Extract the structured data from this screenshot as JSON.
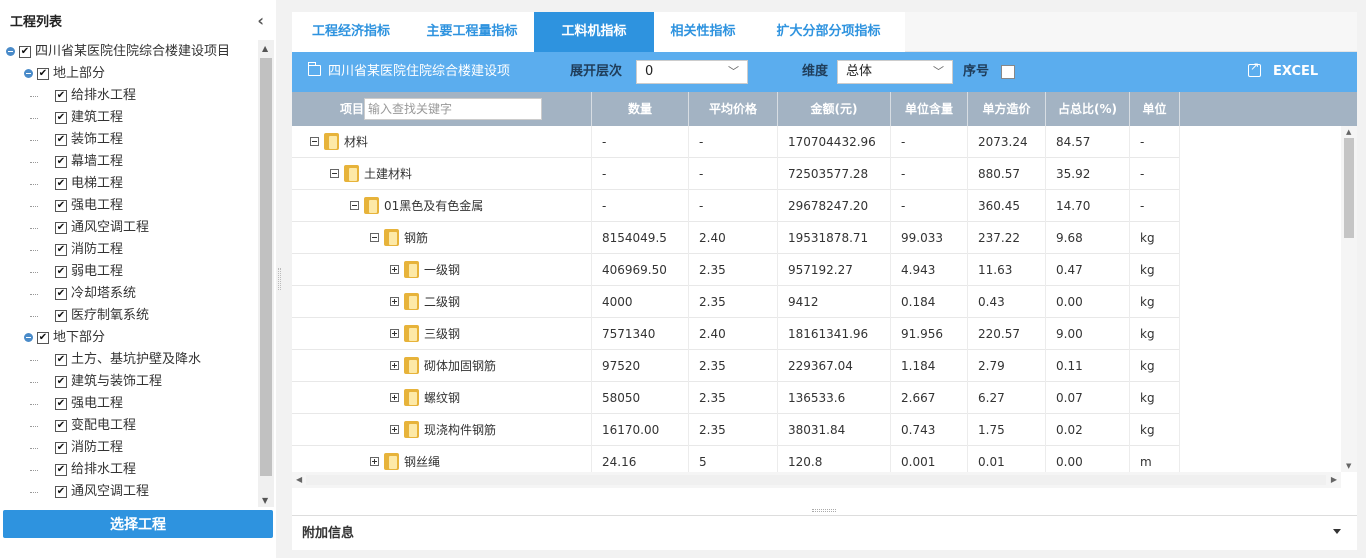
{
  "left_panel": {
    "title": "工程列表",
    "collapse_icon": "chevron-left-icon",
    "tree": [
      {
        "label": "四川省某医院住院综合楼建设项目",
        "level": 0
      },
      {
        "label": "地上部分",
        "level": 1
      },
      {
        "label": "给排水工程",
        "level": 2
      },
      {
        "label": "建筑工程",
        "level": 2
      },
      {
        "label": "装饰工程",
        "level": 2
      },
      {
        "label": "幕墙工程",
        "level": 2
      },
      {
        "label": "电梯工程",
        "level": 2
      },
      {
        "label": "强电工程",
        "level": 2
      },
      {
        "label": "通风空调工程",
        "level": 2
      },
      {
        "label": "消防工程",
        "level": 2
      },
      {
        "label": "弱电工程",
        "level": 2
      },
      {
        "label": "冷却塔系统",
        "level": 2
      },
      {
        "label": "医疗制氧系统",
        "level": 2
      },
      {
        "label": "地下部分",
        "level": 1
      },
      {
        "label": "土方、基坑护壁及降水",
        "level": 2
      },
      {
        "label": "建筑与装饰工程",
        "level": 2
      },
      {
        "label": "强电工程",
        "level": 2
      },
      {
        "label": "变配电工程",
        "level": 2
      },
      {
        "label": "消防工程",
        "level": 2
      },
      {
        "label": "给排水工程",
        "level": 2
      },
      {
        "label": "通风空调工程",
        "level": 2
      }
    ],
    "select_button": "选择工程"
  },
  "tabs": [
    "工程经济指标",
    "主要工程量指标",
    "工料机指标",
    "相关性指标",
    "扩大分部分项指标"
  ],
  "active_tab": 2,
  "toolbar": {
    "project_name": "四川省某医院住院综合楼建设项",
    "expand_level_label": "展开层次",
    "expand_level_value": "0",
    "dimension_label": "维度",
    "dimension_value": "总体",
    "seq_label": "序号",
    "excel_label": "EXCEL"
  },
  "grid": {
    "columns": [
      "项目",
      "数量",
      "平均价格",
      "金额(元)",
      "单位含量",
      "单方造价",
      "占总比(%)",
      "单位"
    ],
    "search_placeholder": "输入查找关键字",
    "rows": [
      {
        "name": "材料",
        "level": 0,
        "toggle": "minus",
        "cells": [
          "-",
          "-",
          "170704432.96",
          "-",
          "2073.24",
          "84.57",
          "-"
        ]
      },
      {
        "name": "土建材料",
        "level": 1,
        "toggle": "minus",
        "cells": [
          "-",
          "-",
          "72503577.28",
          "-",
          "880.57",
          "35.92",
          "-"
        ]
      },
      {
        "name": "01黑色及有色金属",
        "level": 2,
        "toggle": "minus",
        "cells": [
          "-",
          "-",
          "29678247.20",
          "-",
          "360.45",
          "14.70",
          "-"
        ]
      },
      {
        "name": "钢筋",
        "level": 3,
        "toggle": "minus",
        "cells": [
          "8154049.5",
          "2.40",
          "19531878.71",
          "99.033",
          "237.22",
          "9.68",
          "kg"
        ]
      },
      {
        "name": "一级钢",
        "level": 4,
        "toggle": "plus",
        "cells": [
          "406969.50",
          "2.35",
          "957192.27",
          "4.943",
          "11.63",
          "0.47",
          "kg"
        ]
      },
      {
        "name": "二级钢",
        "level": 4,
        "toggle": "plus",
        "cells": [
          "4000",
          "2.35",
          "9412",
          "0.184",
          "0.43",
          "0.00",
          "kg"
        ]
      },
      {
        "name": "三级钢",
        "level": 4,
        "toggle": "plus",
        "cells": [
          "7571340",
          "2.40",
          "18161341.96",
          "91.956",
          "220.57",
          "9.00",
          "kg"
        ]
      },
      {
        "name": "砌体加固钢筋",
        "level": 4,
        "toggle": "plus",
        "cells": [
          "97520",
          "2.35",
          "229367.04",
          "1.184",
          "2.79",
          "0.11",
          "kg"
        ]
      },
      {
        "name": "螺纹钢",
        "level": 4,
        "toggle": "plus",
        "cells": [
          "58050",
          "2.35",
          "136533.6",
          "2.667",
          "6.27",
          "0.07",
          "kg"
        ]
      },
      {
        "name": "现浇构件钢筋",
        "level": 4,
        "toggle": "plus",
        "cells": [
          "16170.00",
          "2.35",
          "38031.84",
          "0.743",
          "1.75",
          "0.02",
          "kg"
        ]
      },
      {
        "name": "钢丝绳",
        "level": 3,
        "toggle": "plus",
        "cells": [
          "24.16",
          "5",
          "120.8",
          "0.001",
          "0.01",
          "0.00",
          "m"
        ]
      }
    ]
  },
  "extra_info": {
    "title": "附加信息"
  }
}
